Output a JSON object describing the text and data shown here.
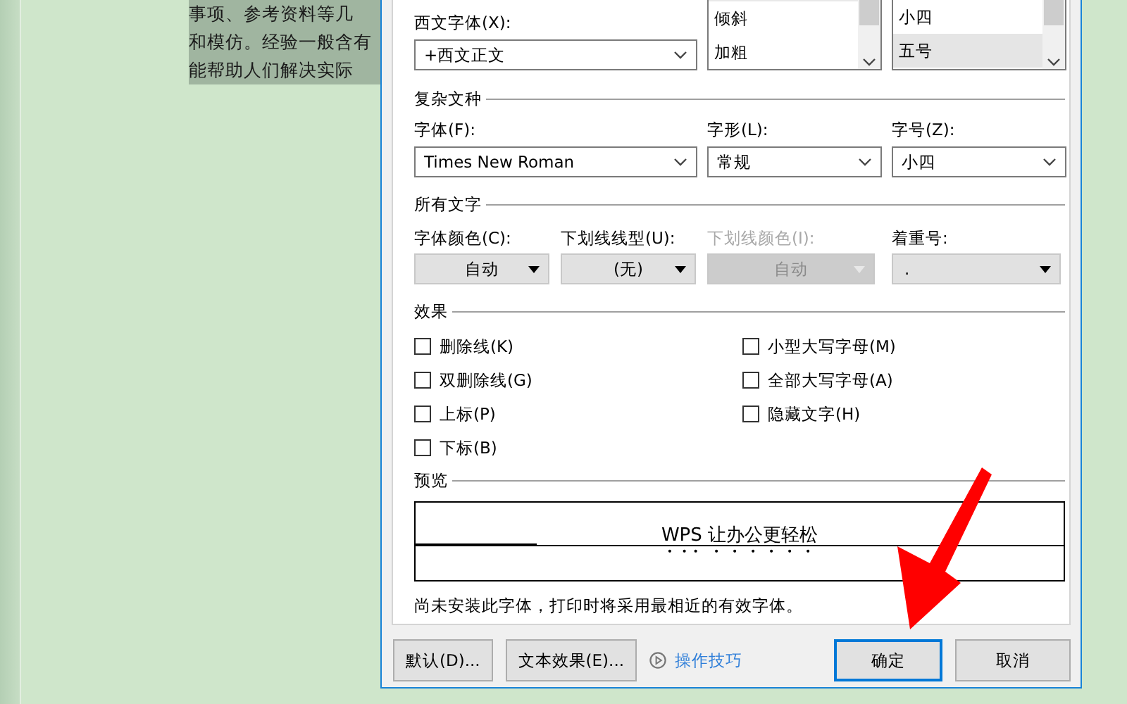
{
  "document": {
    "lines": [
      "事项、参考资料等几",
      "和模仿。经验一般含有",
      "能帮助人们解决实际"
    ]
  },
  "dialog": {
    "western_font": {
      "label": "西文字体(X):",
      "value": "+西文正文"
    },
    "style_list": {
      "items": [
        {
          "label": "倾斜",
          "selected": false
        },
        {
          "label": "加粗",
          "selected": false
        }
      ]
    },
    "size_list": {
      "items": [
        {
          "label": "小四",
          "selected": false
        },
        {
          "label": "五号",
          "selected": true
        }
      ]
    },
    "complex_script": {
      "title": "复杂文种",
      "fields": [
        {
          "label": "字体(F):",
          "value": "Times New Roman"
        },
        {
          "label": "字形(L):",
          "value": "常规"
        },
        {
          "label": "字号(Z):",
          "value": "小四"
        }
      ]
    },
    "all_text": {
      "title": "所有文字",
      "fields": [
        {
          "label": "字体颜色(C):",
          "value": "自动",
          "disabled": false,
          "kind": "color"
        },
        {
          "label": "下划线线型(U):",
          "value": "(无)",
          "disabled": false,
          "kind": "underline"
        },
        {
          "label": "下划线颜色(I):",
          "value": "自动",
          "disabled": true,
          "kind": "underline-color"
        },
        {
          "label": "着重号:",
          "value": ".",
          "disabled": false,
          "kind": "emphasis"
        }
      ]
    },
    "effects": {
      "title": "效果",
      "columns": [
        [
          {
            "label": "删除线(K)",
            "checked": false
          },
          {
            "label": "双删除线(G)",
            "checked": false
          },
          {
            "label": "上标(P)",
            "checked": false
          },
          {
            "label": "下标(B)",
            "checked": false
          }
        ],
        [
          {
            "label": "小型大写字母(M)",
            "checked": false
          },
          {
            "label": "全部大写字母(A)",
            "checked": false
          },
          {
            "label": "隐藏文字(H)",
            "checked": false
          }
        ]
      ]
    },
    "preview": {
      "title": "预览",
      "sample": "WPS 让办公更轻松",
      "note": "尚未安装此字体，打印时将采用最相近的有效字体。"
    },
    "buttons": [
      {
        "label": "默认(D)...",
        "kind": "button"
      },
      {
        "label": "文本效果(E)...",
        "kind": "button"
      },
      {
        "label": "操作技巧",
        "kind": "link"
      },
      {
        "label": "确定",
        "kind": "primary"
      },
      {
        "label": "取消",
        "kind": "button"
      }
    ]
  }
}
